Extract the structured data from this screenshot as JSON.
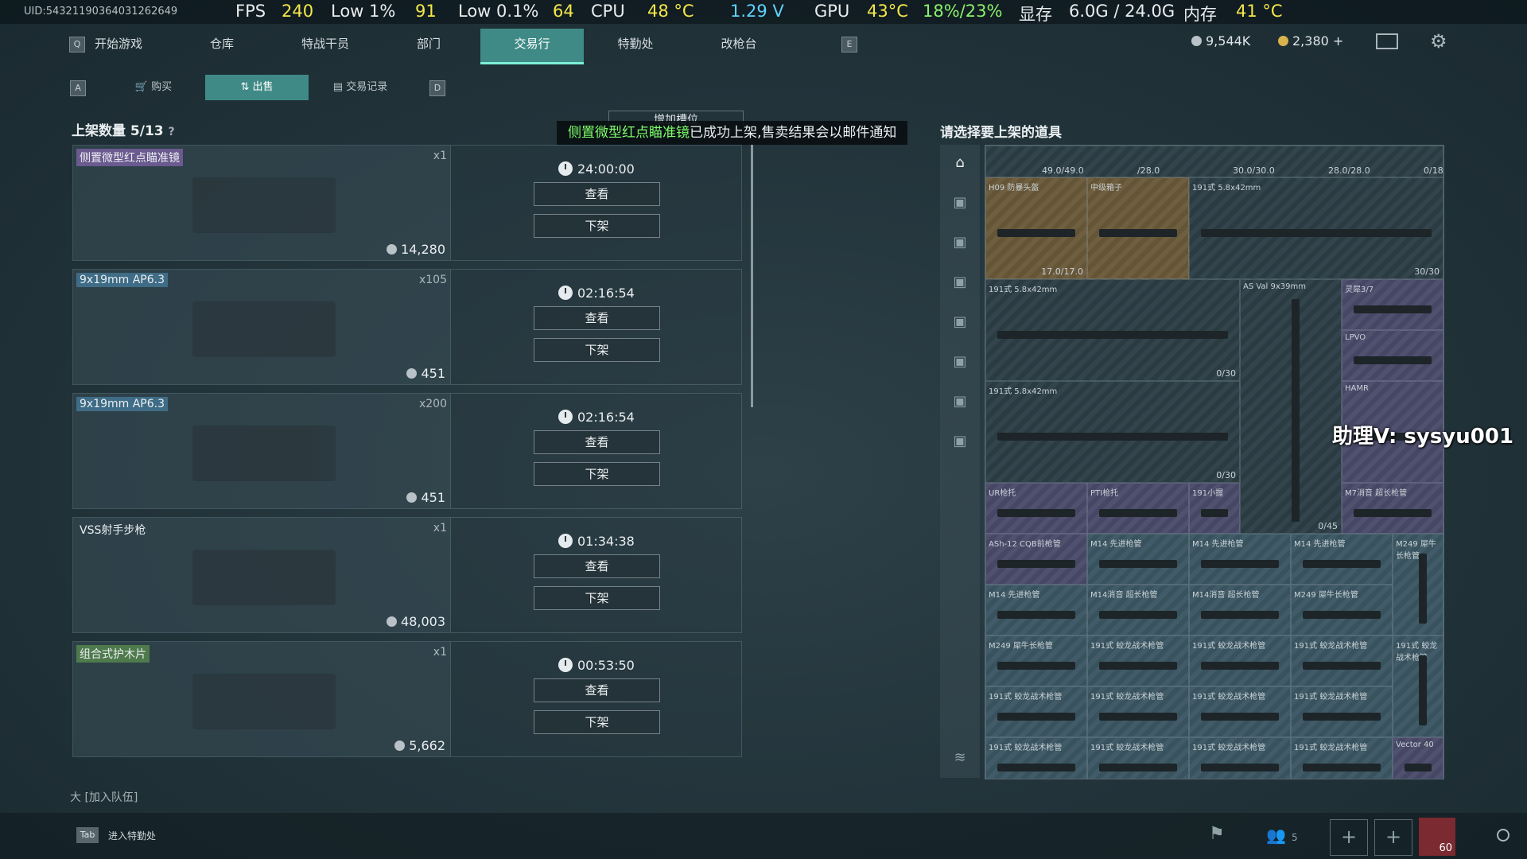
{
  "osd": {
    "uid": "UID:54321190364031262649",
    "fps_label": "FPS",
    "fps": "240",
    "low1_label": "Low 1%",
    "low1": "91",
    "low01_label": "Low 0.1%",
    "low01": "64",
    "cpu_label": "CPU",
    "cpu_temp": "48 °C",
    "voltage": "1.29 V",
    "gpu_label": "GPU",
    "gpu_temp": "43°C",
    "gpu_usage": "18%/23%",
    "vram_label": "显存",
    "vram": "6.0G / 24.0G",
    "mem_label": "内存",
    "mem_temp": "41 °C"
  },
  "nav": {
    "key_left": "Q",
    "key_right": "E",
    "items": [
      "开始游戏",
      "仓库",
      "特战干员",
      "部门",
      "交易行",
      "特勤处",
      "改枪台"
    ],
    "active_index": 4
  },
  "currency": {
    "silver": "9,544K",
    "gold": "2,380 +"
  },
  "subtabs": {
    "key_left": "A",
    "key_right": "D",
    "items": [
      "购买",
      "出售",
      "交易记录"
    ],
    "active_index": 1
  },
  "listings_title": "上架数量 5/13",
  "listings_help": "?",
  "add_slot": "增加槽位",
  "toast": {
    "highlight": "侧置微型红点瞄准镜",
    "message": "已成功上架,售卖结果会以邮件通知"
  },
  "right_title": "请选择要上架的道具",
  "listings": [
    {
      "name": "侧置微型红点瞄准镜",
      "qty": "x1",
      "price": "14,280",
      "timer": "24:00:00",
      "view": "查看",
      "remove": "下架",
      "tag_color": "#6b5a8f"
    },
    {
      "name": "9x19mm AP6.3",
      "qty": "x105",
      "price": "451",
      "timer": "02:16:54",
      "view": "查看",
      "remove": "下架",
      "tag_color": "#3f6c86"
    },
    {
      "name": "9x19mm AP6.3",
      "qty": "x200",
      "price": "451",
      "timer": "02:16:54",
      "view": "查看",
      "remove": "下架",
      "tag_color": "#3f6c86"
    },
    {
      "name": "VSS射手步枪",
      "qty": "x1",
      "price": "48,003",
      "timer": "01:34:38",
      "view": "查看",
      "remove": "下架",
      "tag_color": ""
    },
    {
      "name": "组合式护木片",
      "qty": "x1",
      "price": "5,662",
      "timer": "00:53:50",
      "view": "查看",
      "remove": "下架",
      "tag_color": "#4e7a4c"
    }
  ],
  "inventory": {
    "top_counts": [
      "49.0/49.0",
      "/28.0",
      "30.0/30.0",
      "28.0/28.0",
      "0/18"
    ],
    "cells": [
      {
        "label": "H09 防暴头盔",
        "count": "17.0/17.0"
      },
      {
        "label": "中级箱子",
        "count": ""
      },
      {
        "label": "191式 5.8x42mm",
        "count": "30/30"
      },
      {
        "label": "191式 5.8x42mm",
        "count": "0/30"
      },
      {
        "label": "AS Val 9x39mm",
        "count": "0/45"
      },
      {
        "label": "灵犀3/7",
        "count": ""
      },
      {
        "label": "LPVO",
        "count": ""
      },
      {
        "label": "191式 5.8x42mm",
        "count": "0/30"
      },
      {
        "label": "HAMR",
        "count": ""
      },
      {
        "label": "UR枪托",
        "count": ""
      },
      {
        "label": "PTI枪托",
        "count": ""
      },
      {
        "label": "191小握",
        "count": ""
      },
      {
        "label": "M7消音 超长枪管",
        "count": ""
      },
      {
        "label": "ASh-12 CQB前枪管",
        "count": ""
      },
      {
        "label": "M14 先进枪管",
        "count": ""
      },
      {
        "label": "M14 先进枪管",
        "count": ""
      },
      {
        "label": "M14 先进枪管",
        "count": ""
      },
      {
        "label": "M249 犀牛长枪管",
        "count": ""
      },
      {
        "label": "M14 先进枪管",
        "count": ""
      },
      {
        "label": "M14消音 超长枪管",
        "count": ""
      },
      {
        "label": "M14消音 超长枪管",
        "count": ""
      },
      {
        "label": "M249 犀牛长枪管",
        "count": ""
      },
      {
        "label": "M249 犀牛长枪管",
        "count": ""
      },
      {
        "label": "191式 蛟龙战术枪管",
        "count": ""
      },
      {
        "label": "191式 蛟龙战术枪管",
        "count": ""
      },
      {
        "label": "191式 蛟龙战术枪管",
        "count": ""
      },
      {
        "label": "191式 蛟龙战术枪管",
        "count": ""
      },
      {
        "label": "191式 蛟龙战术枪管",
        "count": ""
      },
      {
        "label": "191式 蛟龙战术枪管",
        "count": ""
      },
      {
        "label": "191式 蛟龙战术枪管",
        "count": ""
      },
      {
        "label": "191式 蛟龙战术枪管",
        "count": ""
      },
      {
        "label": "191式 蛟龙战术枪管",
        "count": ""
      },
      {
        "label": "191式 蛟龙战术枪管",
        "count": ""
      },
      {
        "label": "191式 蛟龙战术枪管",
        "count": ""
      },
      {
        "label": "191式 蛟龙战术枪管",
        "count": ""
      },
      {
        "label": "Vector 40",
        "count": ""
      }
    ]
  },
  "watermark": "助理V: sysyu001",
  "join_team": "大 [加入队伍]",
  "bottom": {
    "tab_key": "Tab",
    "tab_label": "进入特勤处",
    "squad_count": "5",
    "level": "60"
  }
}
